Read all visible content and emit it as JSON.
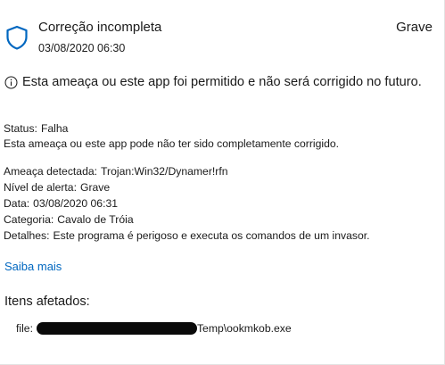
{
  "header": {
    "title": "Correção incompleta",
    "datetime": "03/08/2020 06:30",
    "severity": "Grave"
  },
  "notice": {
    "icon": "info-icon",
    "text": "Esta ameaça ou este app foi permitido e não será corrigido no futuro."
  },
  "status": {
    "label": "Status:",
    "value": "Falha",
    "description": "Esta ameaça ou este app pode não ter sido completamente corrigido."
  },
  "details": [
    {
      "label": "Ameaça detectada:",
      "value": "Trojan:Win32/Dynamer!rfn"
    },
    {
      "label": "Nível de alerta:",
      "value": "Grave"
    },
    {
      "label": "Data:",
      "value": "03/08/2020 06:31"
    },
    {
      "label": "Categoria:",
      "value": "Cavalo de Tróia"
    },
    {
      "label": "Detalhes:",
      "value": "Este programa é perigoso e executa os comandos de um invasor."
    }
  ],
  "learn_more": "Saiba mais",
  "affected": {
    "heading": "Itens afetados:",
    "file_prefix": "file:",
    "file_suffix": "Temp\\ookmkob.exe"
  },
  "colors": {
    "shield": "#0067c0",
    "link": "#0067c0"
  }
}
